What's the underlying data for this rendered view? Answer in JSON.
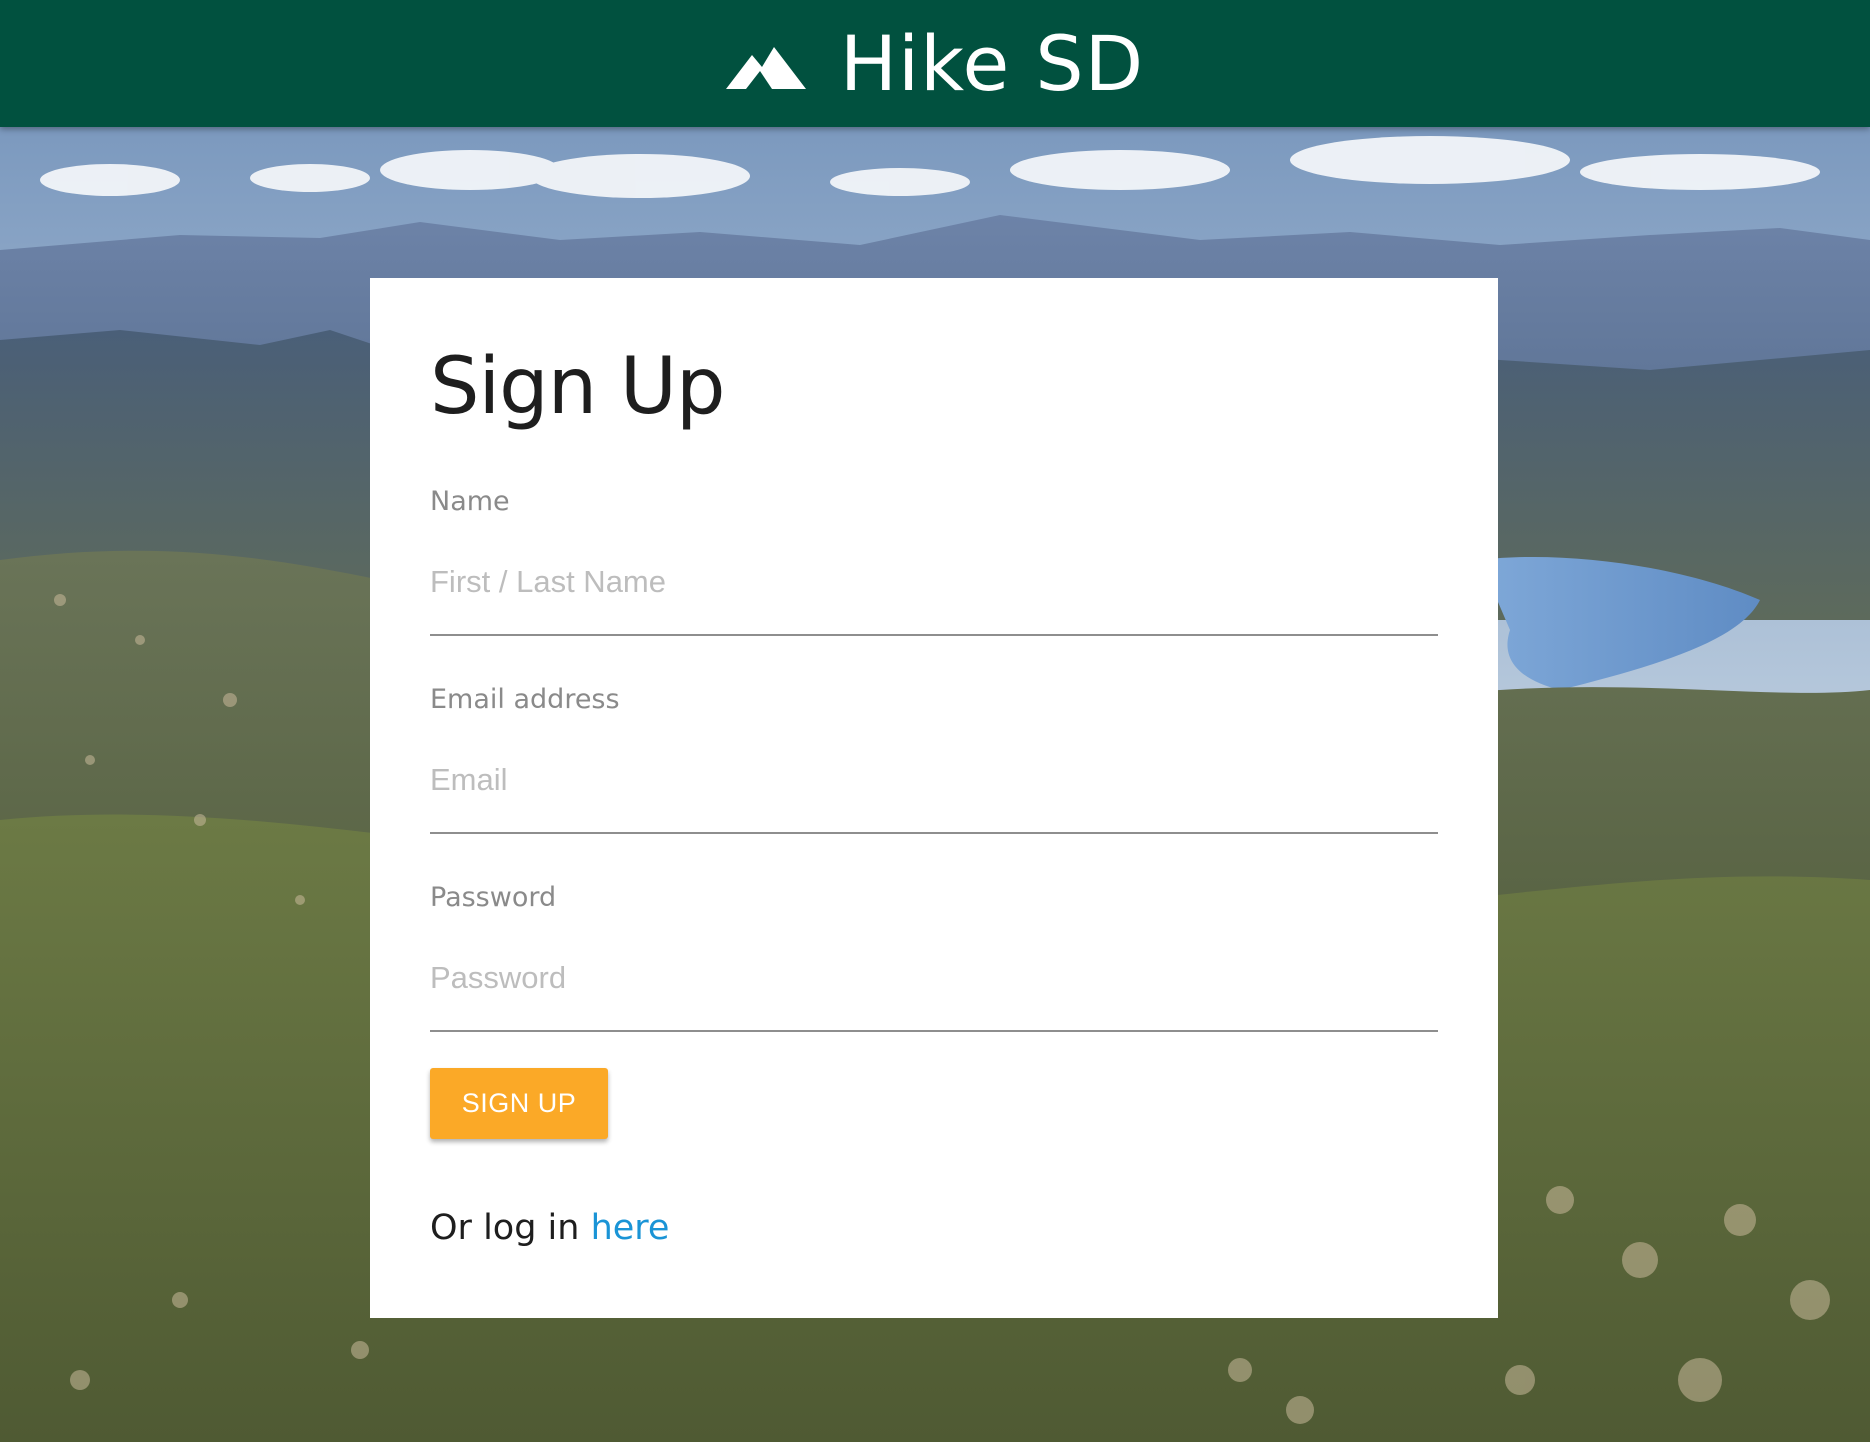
{
  "header": {
    "title": "Hike SD",
    "logo_icon": "mountain-icon",
    "background_color": "#01513f"
  },
  "form": {
    "title": "Sign Up",
    "name": {
      "label": "Name",
      "placeholder": "First / Last Name",
      "value": ""
    },
    "email": {
      "label": "Email address",
      "placeholder": "Email",
      "value": ""
    },
    "password": {
      "label": "Password",
      "placeholder": "Password",
      "value": ""
    },
    "submit_label": "SIGN UP",
    "submit_color": "#fba927",
    "login_prompt": "Or log in",
    "login_link_label": "here",
    "link_color": "#1a94d6"
  }
}
